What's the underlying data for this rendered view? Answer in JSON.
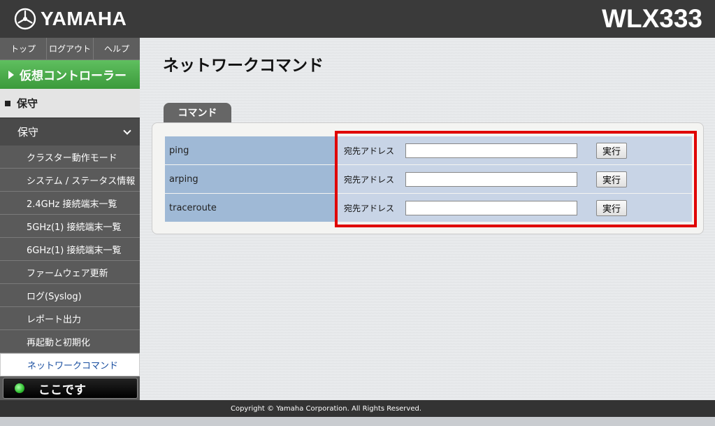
{
  "header": {
    "brand": "YAMAHA",
    "model": "WLX333"
  },
  "sidebar": {
    "topnav": [
      "トップ",
      "ログアウト",
      "ヘルプ"
    ],
    "virtual_controller": "仮想コントローラー",
    "section": "保守",
    "group": "保守",
    "items": [
      "クラスター動作モード",
      "システム / ステータス情報",
      "2.4GHz 接続端末一覧",
      "5GHz(1) 接続端末一覧",
      "6GHz(1) 接続端末一覧",
      "ファームウェア更新",
      "ログ(Syslog)",
      "レポート出力",
      "再起動と初期化",
      "ネットワークコマンド"
    ],
    "active_item": "ネットワークコマンド",
    "here_label": "ここです"
  },
  "main": {
    "title": "ネットワークコマンド",
    "tab": "コマンド",
    "commands": [
      {
        "name": "ping",
        "field_label": "宛先アドレス",
        "value": "",
        "button": "実行"
      },
      {
        "name": "arping",
        "field_label": "宛先アドレス",
        "value": "",
        "button": "実行"
      },
      {
        "name": "traceroute",
        "field_label": "宛先アドレス",
        "value": "",
        "button": "実行"
      }
    ]
  },
  "footer": {
    "copyright": "Copyright © Yamaha Corporation. All Rights Reserved."
  },
  "colors": {
    "header": "#3a3a3a",
    "accent_green": "#3b9a3b",
    "highlight_red": "#e00000",
    "cell_blue": "#9fb9d6"
  }
}
